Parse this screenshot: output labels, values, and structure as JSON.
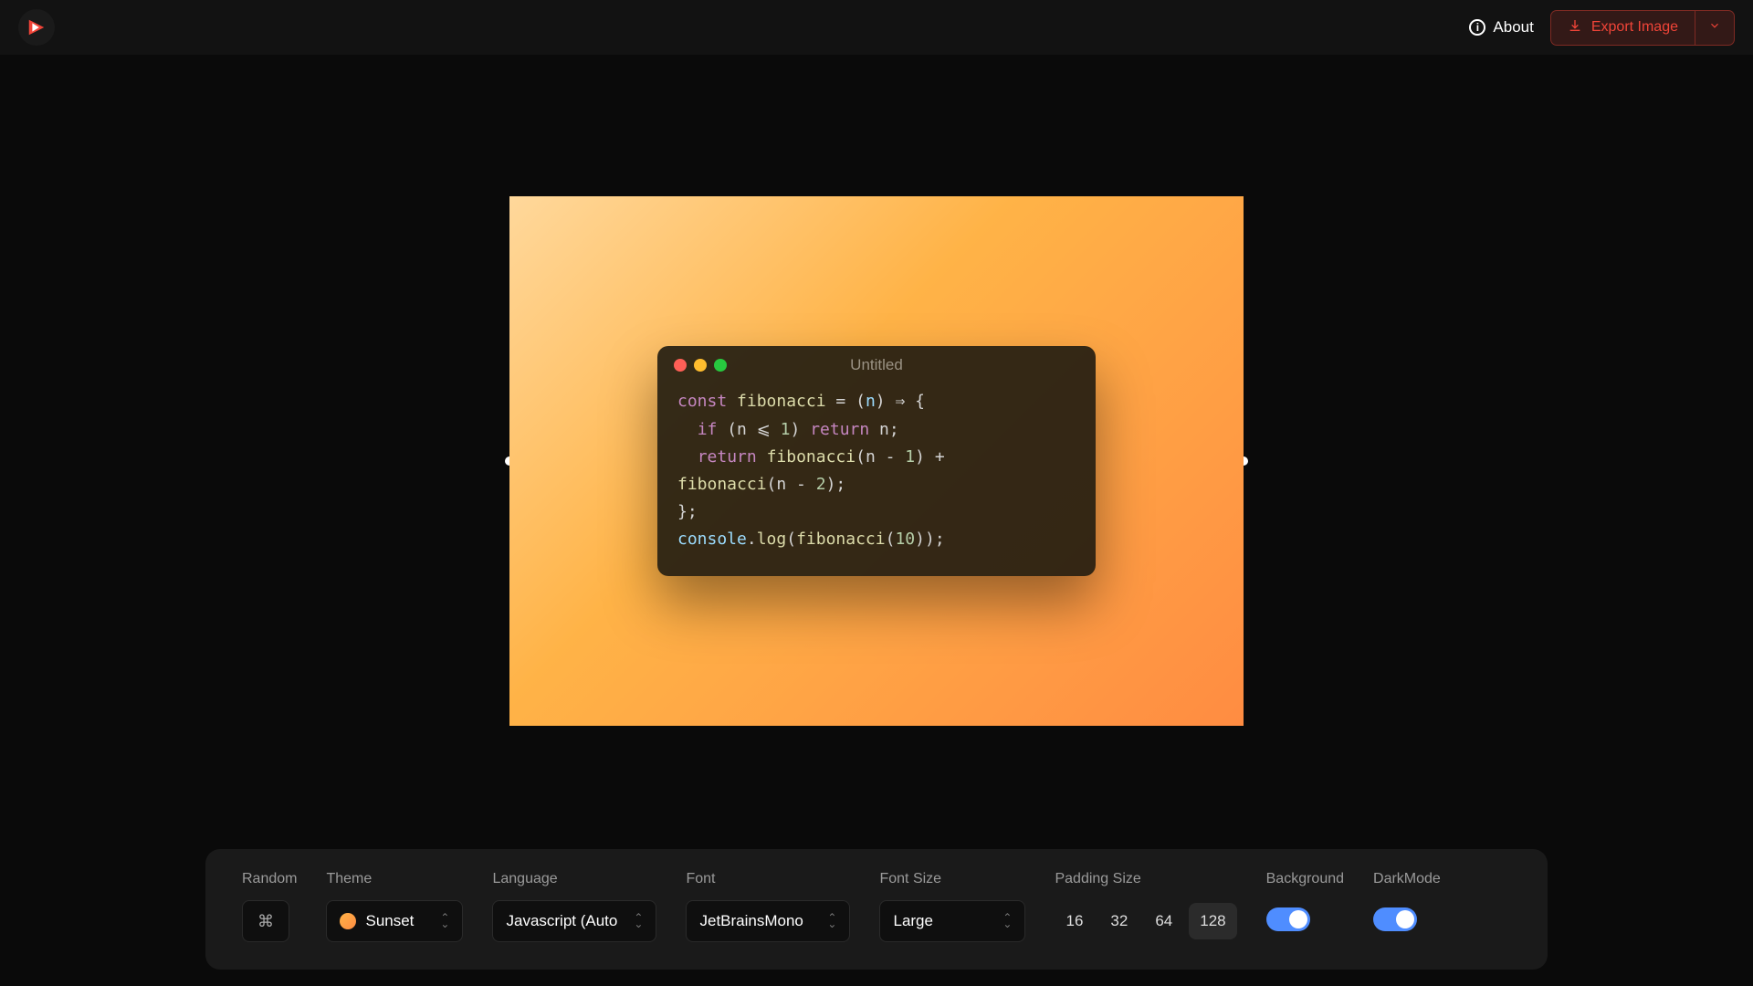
{
  "header": {
    "about_label": "About",
    "export_label": "Export Image"
  },
  "frame": {
    "window_title": "Untitled",
    "code_tokens": [
      {
        "t": "const",
        "c": "tok-kw"
      },
      {
        "t": " ",
        "c": ""
      },
      {
        "t": "fibonacci",
        "c": "tok-fn"
      },
      {
        "t": " = (",
        "c": "tok-punc"
      },
      {
        "t": "n",
        "c": "tok-param"
      },
      {
        "t": ") ⇒ {",
        "c": "tok-punc"
      },
      {
        "t": "\n  ",
        "c": ""
      },
      {
        "t": "if",
        "c": "tok-kw"
      },
      {
        "t": " (n ⩽ ",
        "c": "tok-punc"
      },
      {
        "t": "1",
        "c": "tok-num"
      },
      {
        "t": ") ",
        "c": "tok-punc"
      },
      {
        "t": "return",
        "c": "tok-kw"
      },
      {
        "t": " n;",
        "c": "tok-punc"
      },
      {
        "t": "\n  ",
        "c": ""
      },
      {
        "t": "return",
        "c": "tok-kw"
      },
      {
        "t": " ",
        "c": ""
      },
      {
        "t": "fibonacci",
        "c": "tok-call"
      },
      {
        "t": "(n - ",
        "c": "tok-punc"
      },
      {
        "t": "1",
        "c": "tok-num"
      },
      {
        "t": ") + ",
        "c": "tok-punc"
      },
      {
        "t": "\n",
        "c": ""
      },
      {
        "t": "fibonacci",
        "c": "tok-call"
      },
      {
        "t": "(n - ",
        "c": "tok-punc"
      },
      {
        "t": "2",
        "c": "tok-num"
      },
      {
        "t": ");",
        "c": "tok-punc"
      },
      {
        "t": "\n",
        "c": ""
      },
      {
        "t": "};",
        "c": "tok-punc"
      },
      {
        "t": "\n",
        "c": ""
      },
      {
        "t": "console",
        "c": "tok-param"
      },
      {
        "t": ".",
        "c": "tok-punc"
      },
      {
        "t": "log",
        "c": "tok-method"
      },
      {
        "t": "(",
        "c": "tok-punc"
      },
      {
        "t": "fibonacci",
        "c": "tok-call"
      },
      {
        "t": "(",
        "c": "tok-punc"
      },
      {
        "t": "10",
        "c": "tok-num"
      },
      {
        "t": "));",
        "c": "tok-punc"
      }
    ]
  },
  "toolbar": {
    "random_label": "Random",
    "theme_label": "Theme",
    "theme_value": "Sunset",
    "language_label": "Language",
    "language_value": "Javascript (Auto",
    "font_label": "Font",
    "font_value": "JetBrainsMono",
    "fontsize_label": "Font Size",
    "fontsize_value": "Large",
    "padding_label": "Padding Size",
    "padding_options": [
      "16",
      "32",
      "64",
      "128"
    ],
    "padding_selected": "128",
    "background_label": "Background",
    "darkmode_label": "DarkMode",
    "background_on": true,
    "darkmode_on": true
  }
}
